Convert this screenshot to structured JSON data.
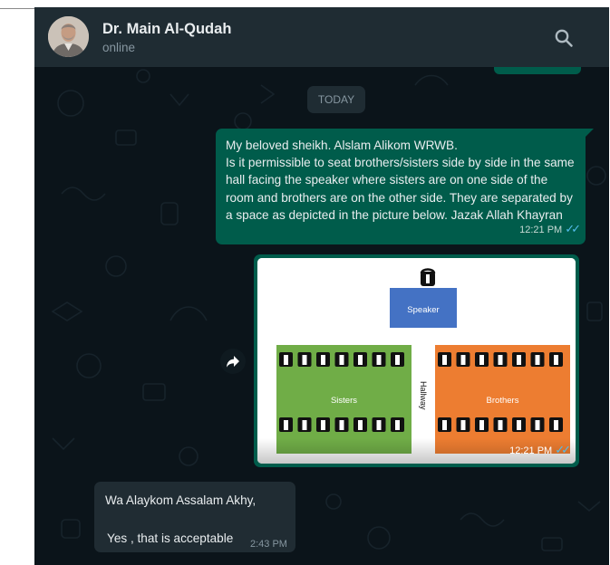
{
  "header": {
    "contact_name": "Dr. Main Al-Qudah",
    "contact_status": "online",
    "search_icon": "search-icon"
  },
  "chat": {
    "date_divider": "TODAY",
    "outgoing_text": {
      "text": "My beloved sheikh. Alslam Alikom WRWB.\nIs it permissible to seat brothers/sisters side by side in the same hall facing the speaker where sisters are on one side of the room and brothers are on the other side. They are separated by a space as depicted in the picture below.  Jazak Allah Khayran",
      "time": "12:21 PM",
      "status_icon": "double-check-icon"
    },
    "outgoing_image": {
      "time": "12:21 PM",
      "status_icon": "double-check-icon",
      "diagram": {
        "speaker_label": "Speaker",
        "hallway_label": "Hallway",
        "left_section_label": "Sisters",
        "right_section_label": "Brothers",
        "colors": {
          "speaker": "#4472c4",
          "sisters": "#70ad47",
          "brothers": "#ed7d31"
        }
      }
    },
    "forward_icon": "forward-arrow-icon",
    "incoming": {
      "line1": "Wa Alaykom Assalam Akhy,",
      "line2": "Yes , that is acceptable",
      "time": "2:43 PM"
    }
  },
  "theme": {
    "header_bg": "#1f2c33",
    "chat_bg": "#0b141a",
    "outgoing_bubble": "#005c4b",
    "incoming_bubble": "#202c33",
    "read_ticks": "#53bdeb"
  }
}
